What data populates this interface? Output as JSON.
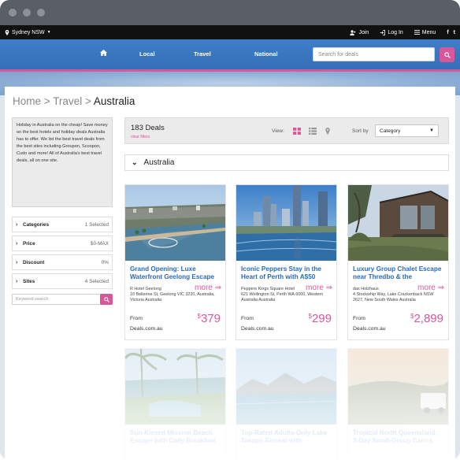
{
  "topbar": {
    "location": "Sydney NSW",
    "join": "Join",
    "login": "Log In",
    "menu": "Menu",
    "social": [
      "f",
      "t"
    ]
  },
  "nav": {
    "links": [
      "Local",
      "Travel",
      "National"
    ],
    "search_placeholder": "Search for deals"
  },
  "breadcrumb": {
    "home": "Home",
    "sep": ">",
    "travel": "Travel",
    "current": "Australia"
  },
  "intro": "Holiday in Australia on the cheap! Save money on the best hotels and holiday deals Australia has to offer. We list the best travel deals from the best sites including Groupon, Scoopon, Cudo and more! All of Australia's best travel deals, all on one site.",
  "filters": [
    {
      "label": "Categories",
      "value": "1 Selected"
    },
    {
      "label": "Price",
      "value": "$0-MAX"
    },
    {
      "label": "Discount",
      "value": "0%"
    },
    {
      "label": "Sites",
      "value": "4 Selected"
    }
  ],
  "keyword_placeholder": "Keyword search",
  "results": {
    "count": "183 Deals",
    "clear": "clear filters",
    "view_label": "View:",
    "sort_label": "Sort by",
    "sort_value": "Category"
  },
  "region": "Australia",
  "cards": [
    {
      "title": "Grand Opening: Luxe Waterfront Geelong Escape",
      "more": "more ⇒",
      "address": "R Hotel Geelong\n10 Bellerine St, Geelong VIC 3220, Australia, Victoria Australia",
      "from": "From",
      "provider": "Deals.com.au",
      "currency": "$",
      "price": "379"
    },
    {
      "title": "Iconic Peppers Stay in the Heart of Perth with A$50",
      "more": "more ⇒",
      "address": "Peppers Kings Square Hotel\n621 Wellington St, Perth WA 6000, Western Australia Australia",
      "from": "From",
      "provider": "Deals.com.au",
      "currency": "$",
      "price": "299"
    },
    {
      "title": "Luxury Group Chalet Escape near Thredbo & the",
      "more": "more ⇒",
      "address": "das Holzhaus\n4 Stockwhip Way, Lake Crackenback NSW 2627, New South Wales Australia",
      "from": "From",
      "provider": "Deals.com.au",
      "currency": "$",
      "price": "2,899"
    },
    {
      "title": "Sun-Kissed Mission Beach Escape with Daily Breakfast"
    },
    {
      "title": "Top-Rated Adults-Only Lake Tekapo Retreat with"
    },
    {
      "title": "Tropical North Queensland: 3-Day Small-Group Cairns"
    }
  ],
  "colors": {
    "accent": "#d8569a",
    "nav_blue": "#3a76c0",
    "title_blue": "#2a6ab8"
  }
}
